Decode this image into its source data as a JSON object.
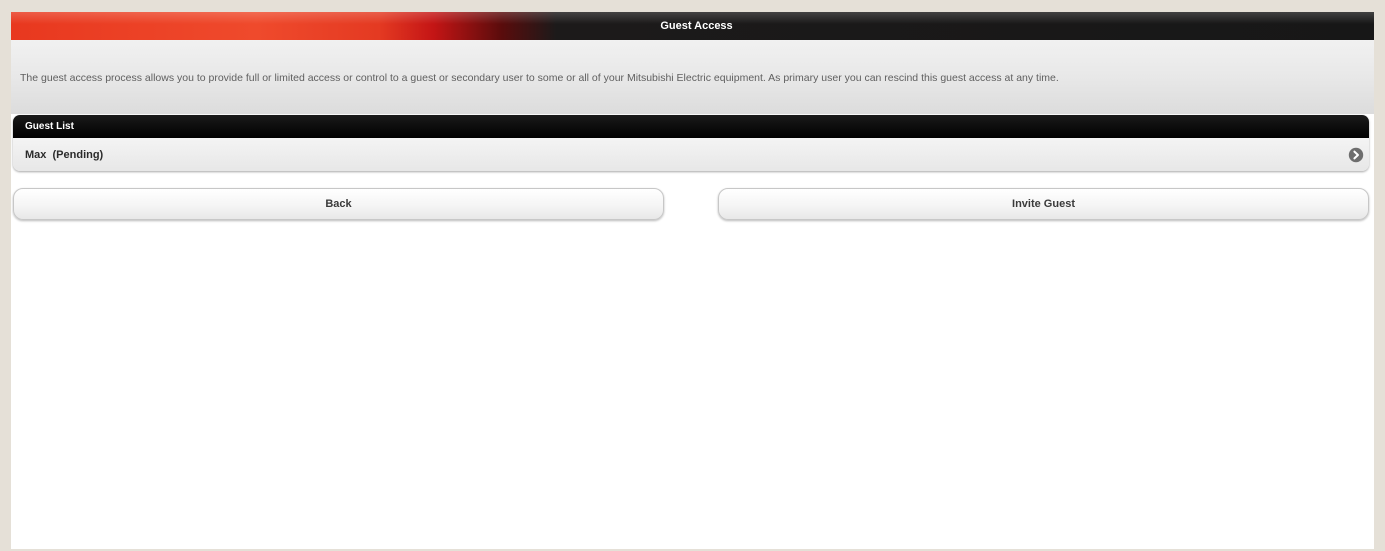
{
  "header": {
    "title": "Guest Access"
  },
  "intro": {
    "text": "The guest access process allows you to provide full or limited access or control to a guest or secondary user to some or all of your Mitsubishi Electric equipment. As primary user you can rescind this guest access at any time."
  },
  "guest_list": {
    "heading": "Guest List",
    "items": [
      {
        "label": "Max  (Pending)",
        "icon": "chevron-right-circle-icon"
      }
    ]
  },
  "actions": {
    "back_label": "Back",
    "invite_label": "Invite Guest"
  },
  "colors": {
    "brand_red": "#e8381f",
    "header_dark": "#171717",
    "page_background": "#e5e0d7"
  }
}
